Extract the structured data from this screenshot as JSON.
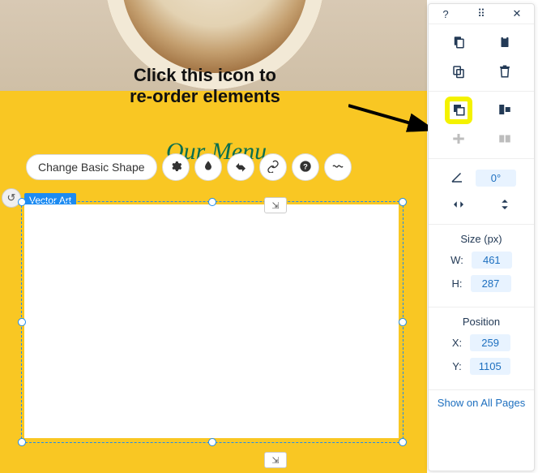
{
  "annotation": {
    "line1": "Click this icon to",
    "line2": "re-order elements"
  },
  "menu_heading": "Our Menu",
  "toolbar": {
    "change_shape_label": "Change Basic Shape"
  },
  "selection": {
    "label": "Vector Art"
  },
  "panel": {
    "rotation": {
      "value": "0°"
    },
    "size": {
      "title": "Size (px)",
      "w_label": "W:",
      "w_value": "461",
      "h_label": "H:",
      "h_value": "287"
    },
    "position": {
      "title": "Position",
      "x_label": "X:",
      "x_value": "259",
      "y_label": "Y:",
      "y_value": "1105"
    },
    "show_all_label": "Show on All Pages"
  }
}
